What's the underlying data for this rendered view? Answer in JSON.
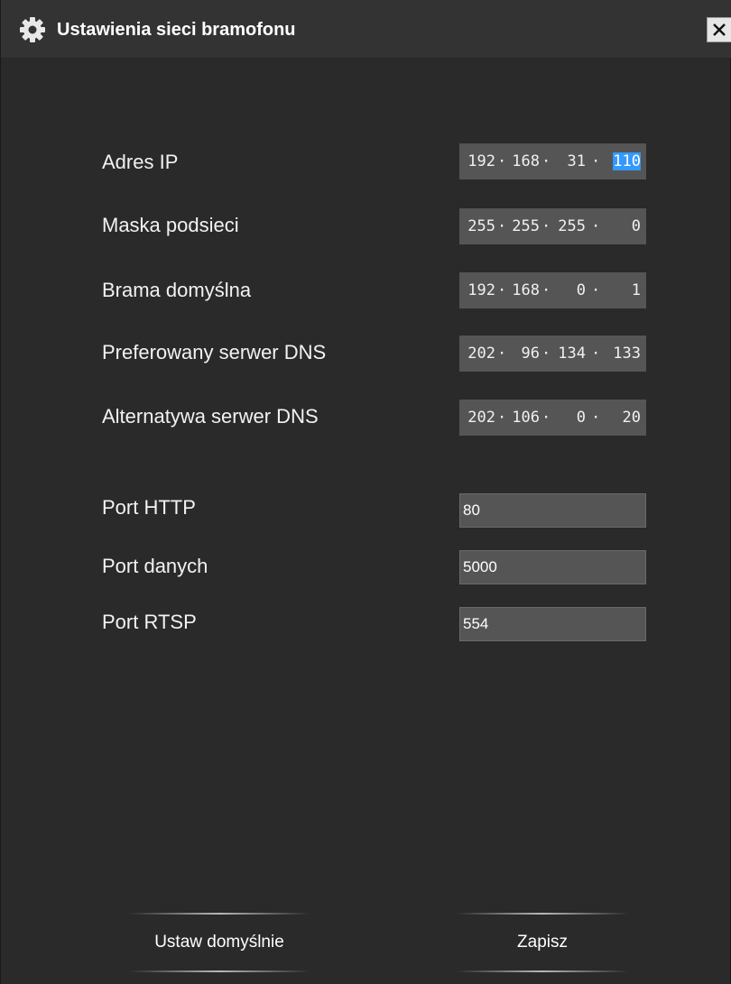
{
  "window": {
    "title": "Ustawienia sieci bramofonu",
    "icon": "gear-icon",
    "close_glyph": "✕"
  },
  "network": [
    {
      "label": "Adres IP",
      "octets": [
        "192",
        "168",
        "31",
        "110"
      ],
      "selected_octet": 4
    },
    {
      "label": "Maska podsieci",
      "octets": [
        "255",
        "255",
        "255",
        "0"
      ]
    },
    {
      "label": "Brama domyślna",
      "octets": [
        "192",
        "168",
        "0",
        "1"
      ]
    },
    {
      "label": "Preferowany serwer DNS",
      "octets": [
        "202",
        "96",
        "134",
        "133"
      ]
    },
    {
      "label": "Alternatywa serwer DNS",
      "octets": [
        "202",
        "106",
        "0",
        "20"
      ]
    }
  ],
  "separator": "·",
  "ports": [
    {
      "label": "Port HTTP",
      "value": "80"
    },
    {
      "label": "Port danych",
      "value": "5000"
    },
    {
      "label": "Port RTSP",
      "value": "554"
    }
  ],
  "buttons": {
    "defaults_label": "Ustaw domyślnie",
    "save_label": "Zapisz"
  },
  "colors": {
    "background": "#2a2a2a",
    "field": "#555555",
    "selection": "#3399ff",
    "text": "#ffffff"
  }
}
